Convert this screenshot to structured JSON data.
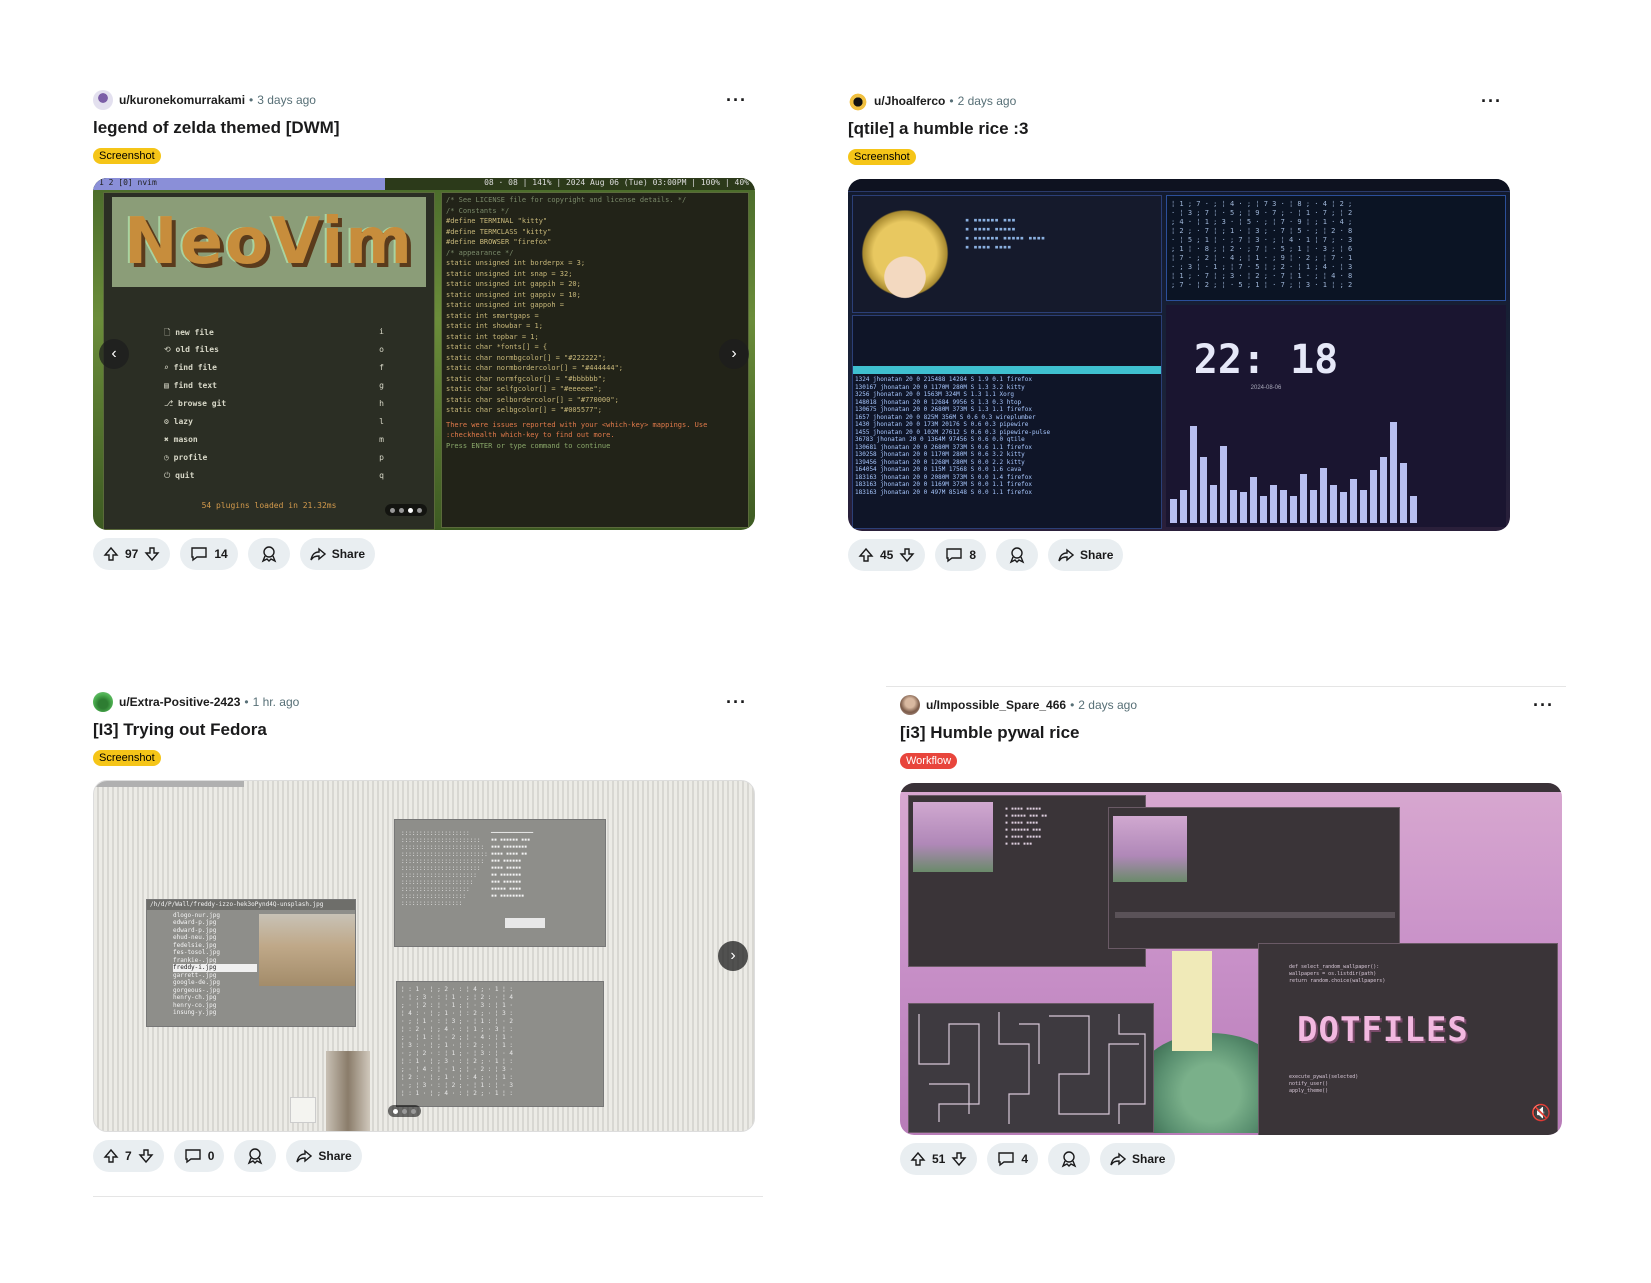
{
  "posts": [
    {
      "username": "u/kuronekomurrakami",
      "time": "3 days ago",
      "title": "legend of zelda themed [DWM]",
      "flair": "Screenshot",
      "votes": "97",
      "comments": "14",
      "share": "Share",
      "screenshot": {
        "bar_left": "1 2 [0] nvim",
        "bar_right": "08 · 08 | 141% | 2024 Aug 06 (Tue) 03:00PM | 100% | 40%",
        "menu": [
          "new file",
          "old files",
          "find file",
          "find text",
          "browse git",
          "lazy",
          "mason",
          "profile",
          "quit"
        ],
        "menu_keys": [
          "i",
          "o",
          "f",
          "g",
          "h",
          "l",
          "m",
          "p",
          "q"
        ],
        "plugins": "54 plugins loaded in 21.32ms",
        "logo": "NeoVim",
        "code": [
          "/* See LICENSE file for copyright and license details. */",
          "/* Constants */",
          "#define TERMINAL \"kitty\"",
          "#define TERMCLASS \"kitty\"",
          "#define BROWSER \"firefox\"",
          "/* appearance */",
          "static unsigned int borderpx = 3;",
          "static unsigned int snap = 32;",
          "static unsigned int gappih = 20;",
          "static unsigned int gappiv = 10;",
          "static unsigned int gappoh =",
          "static int smartgaps =",
          "static int showbar = 1;",
          "static int topbar = 1;",
          "static char *fonts[] = {",
          "static char normbgcolor[] = \"#222222\";",
          "static char normbordercolor[] = \"#444444\";",
          "static char normfgcolor[] = \"#bbbbbb\";",
          "static char selfgcolor[] = \"#eeeeee\";",
          "static char selbordercolor[] = \"#770000\";",
          "static char selbgcolor[] = \"#005577\";"
        ],
        "warning": "There were issues reported with your <which-key> mappings. Use :checkhealth which-key to find out more.",
        "prompt": "Press ENTER or type command to continue"
      }
    },
    {
      "username": "u/Jhoalferco",
      "time": "2 days ago",
      "title": "[qtile] a humble rice :3",
      "flair": "Screenshot",
      "votes": "45",
      "comments": "8",
      "share": "Share",
      "screenshot": {
        "clock": "22: 18",
        "date": "2024-08-06"
      }
    },
    {
      "username": "u/Extra-Positive-2423",
      "time": "1 hr. ago",
      "title": "[I3] Trying out Fedora",
      "flair": "Screenshot",
      "votes": "7",
      "comments": "0",
      "share": "Share",
      "screenshot": {
        "files": [
          "dlogo-nur.jpg",
          "edward-p.jpg",
          "edward-p.jpg",
          "ehud-neu.jpg",
          "fedelsie.jpg",
          "fes-tosol.jpg",
          "frankie-.jpg",
          "freddy-i.jpg",
          "garrett-.jpg",
          "google-de.jpg",
          "gorgeous-.jpg",
          "henry-ch.jpg",
          "henry-co.jpg",
          "insung-y.jpg"
        ],
        "window_title": "/h/d/P/Wall/freddy-izzo-hek3oPynd4Q-unsplash.jpg"
      }
    },
    {
      "username": "u/Impossible_Spare_466",
      "time": "2 days ago",
      "title": "[i3] Humble pywal rice",
      "flair": "Workflow",
      "votes": "51",
      "comments": "4",
      "share": "Share",
      "screenshot": {
        "dotfiles": "DOTFILES"
      }
    }
  ],
  "colors": {
    "flair_yellow": "#f5c518",
    "flair_red": "#e8453c",
    "pill_bg": "#e9eef1"
  }
}
